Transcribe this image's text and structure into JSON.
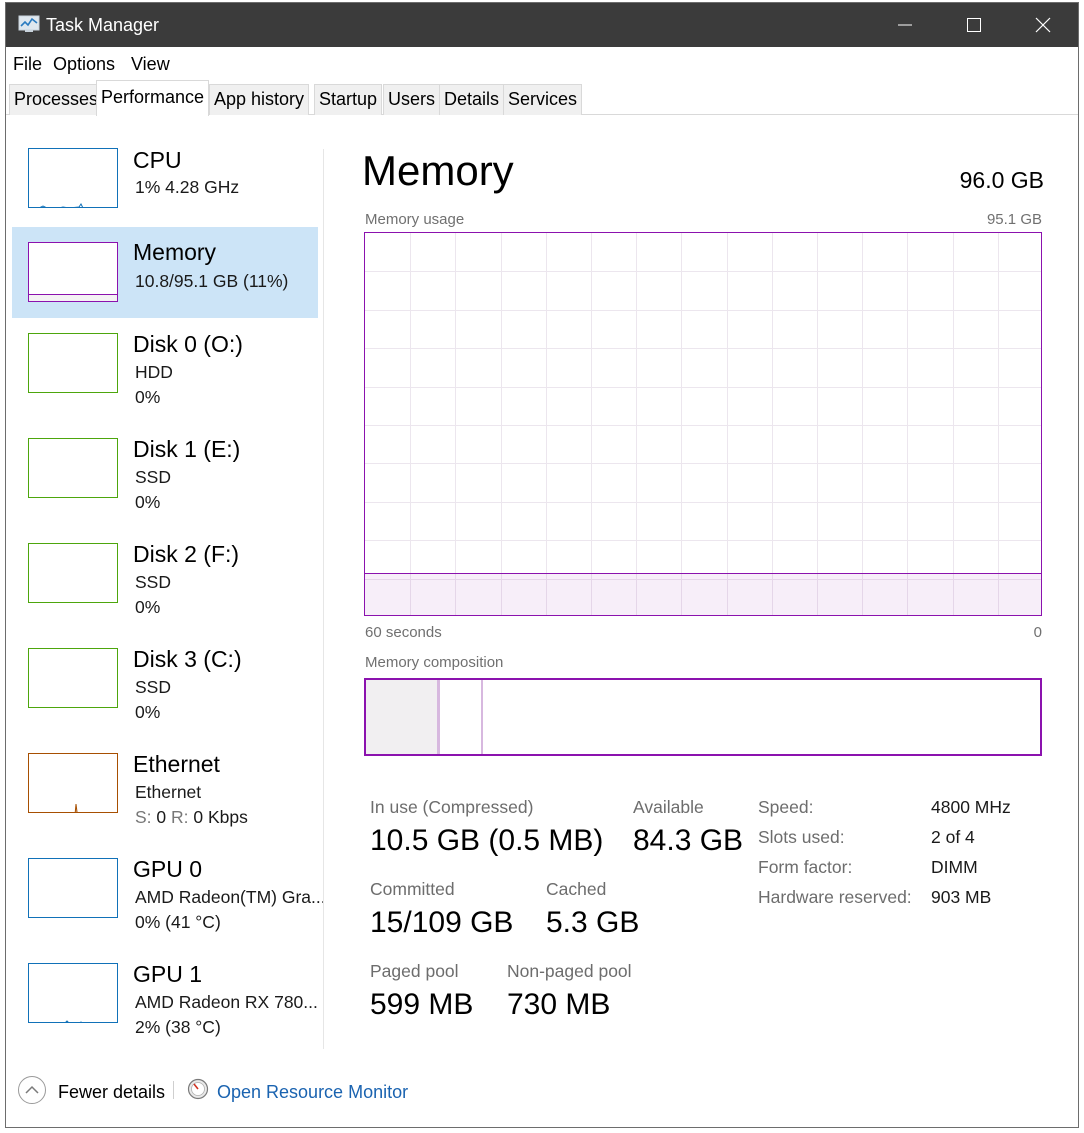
{
  "window": {
    "title": "Task Manager"
  },
  "menu": [
    "File",
    "Options",
    "View"
  ],
  "tabs": [
    "Processes",
    "Performance",
    "App history",
    "Startup",
    "Users",
    "Details",
    "Services"
  ],
  "active_tab": "Performance",
  "sidebar": {
    "cpu": {
      "title": "CPU",
      "sub1": "1%  4.28 GHz",
      "color": "#1171b8"
    },
    "memory": {
      "title": "Memory",
      "sub1": "10.8/95.1 GB (11%)",
      "color": "#8b12ae",
      "usage_fraction": 0.11
    },
    "disk0": {
      "title": "Disk 0 (O:)",
      "sub1": "HDD",
      "sub2": "0%",
      "color": "#4da60c"
    },
    "disk1": {
      "title": "Disk 1 (E:)",
      "sub1": "SSD",
      "sub2": "0%",
      "color": "#4da60c"
    },
    "disk2": {
      "title": "Disk 2 (F:)",
      "sub1": "SSD",
      "sub2": "0%",
      "color": "#4da60c"
    },
    "disk3": {
      "title": "Disk 3 (C:)",
      "sub1": "SSD",
      "sub2": "0%",
      "color": "#4da60c"
    },
    "ethernet": {
      "title": "Ethernet",
      "sub1": "Ethernet",
      "send_label": "S:",
      "send_value": "0",
      "recv_label": "R:",
      "recv_value": "0 Kbps",
      "color": "#a74f01"
    },
    "gpu0": {
      "title": "GPU 0",
      "sub1": "AMD Radeon(TM) Gra...",
      "sub2": "0% (41 °C)",
      "color": "#1171b8"
    },
    "gpu1": {
      "title": "GPU 1",
      "sub1": "AMD Radeon RX 780...",
      "sub2": "2% (38 °C)",
      "color": "#1171b8"
    }
  },
  "main": {
    "title": "Memory",
    "total": "96.0 GB",
    "usage_label": "Memory usage",
    "usage_max": "95.1 GB",
    "usage_fraction": 0.11,
    "axis_left": "60 seconds",
    "axis_right": "0",
    "composition_label": "Memory composition",
    "composition": {
      "in_use_fraction": 0.11,
      "modified_fraction": 0.005,
      "standby_fraction": 0.055
    },
    "stats": {
      "in_use_label": "In use (Compressed)",
      "in_use_value": "10.5 GB (0.5 MB)",
      "available_label": "Available",
      "available_value": "84.3 GB",
      "committed_label": "Committed",
      "committed_value": "15/109 GB",
      "cached_label": "Cached",
      "cached_value": "5.3 GB",
      "paged_label": "Paged pool",
      "paged_value": "599 MB",
      "nonpaged_label": "Non-paged pool",
      "nonpaged_value": "730 MB"
    },
    "specs": {
      "speed_label": "Speed:",
      "speed_value": "4800 MHz",
      "slots_label": "Slots used:",
      "slots_value": "2 of 4",
      "form_label": "Form factor:",
      "form_value": "DIMM",
      "hwres_label": "Hardware reserved:",
      "hwres_value": "903 MB"
    },
    "accent_color": "#8b12ae"
  },
  "footer": {
    "fewer_details": "Fewer details",
    "resource_monitor": "Open Resource Monitor"
  }
}
